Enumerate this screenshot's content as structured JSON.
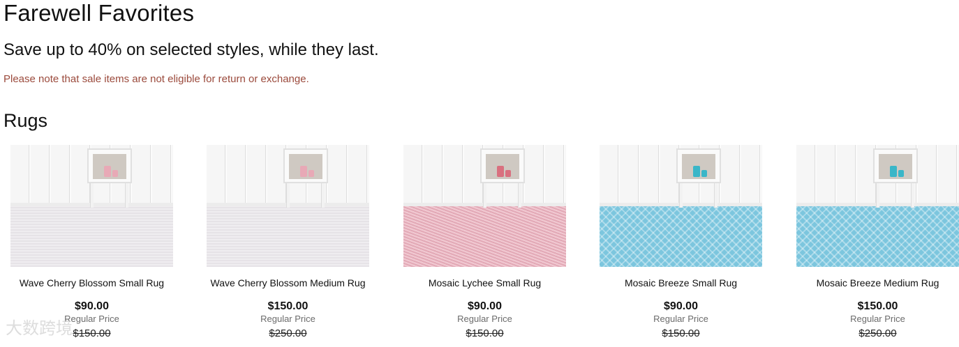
{
  "header": {
    "title": "Farewell Favorites",
    "subtitle": "Save up to 40% on selected styles, while they last.",
    "note": "Please note that sale items are not eligible for return or exchange.",
    "note_color": "#9b4a3c"
  },
  "section": {
    "title": "Rugs"
  },
  "products": [
    {
      "name": "Wave Cherry Blossom Small Rug",
      "price": "$90.00",
      "regular_label": "Regular Price",
      "regular_price": "$150.00",
      "rug_color": "white",
      "vase_color": "#e8a9b6"
    },
    {
      "name": "Wave Cherry Blossom Medium Rug",
      "price": "$150.00",
      "regular_label": "Regular Price",
      "regular_price": "$250.00",
      "rug_color": "white",
      "vase_color": "#e8a9b6"
    },
    {
      "name": "Mosaic Lychee Small Rug",
      "price": "$90.00",
      "regular_label": "Regular Price",
      "regular_price": "$150.00",
      "rug_color": "pink",
      "vase_color": "#d9707f"
    },
    {
      "name": "Mosaic Breeze Small Rug",
      "price": "$90.00",
      "regular_label": "Regular Price",
      "regular_price": "$150.00",
      "rug_color": "blue",
      "vase_color": "#3ab6c8"
    },
    {
      "name": "Mosaic Breeze Medium Rug",
      "price": "$150.00",
      "regular_label": "Regular Price",
      "regular_price": "$250.00",
      "rug_color": "blue",
      "vase_color": "#3ab6c8"
    }
  ],
  "watermark": "大数跨境"
}
